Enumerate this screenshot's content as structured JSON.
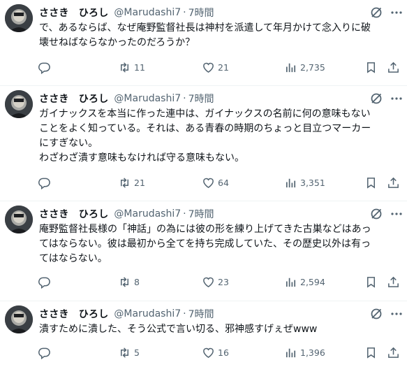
{
  "tweets": [
    {
      "name": "ささき　ひろし",
      "handle": "@Marudashi7",
      "dot": "·",
      "time": "7時間",
      "lines": [
        "で、あるならば、なぜ庵野監督社長は神村を派遣して年月かけて念入りに破",
        "壊せねばならなかったのだろうか？"
      ],
      "replies": "",
      "retweets": "11",
      "likes": "21",
      "views": "2,735"
    },
    {
      "name": "ささき　ひろし",
      "handle": "@Marudashi7",
      "dot": "·",
      "time": "7時間",
      "lines": [
        "ガイナックスを本当に作った連中は、ガイナックスの名前に何の意味もない",
        "ことをよく知っている。それは、ある青春の時期のちょっと目立つマーカー",
        "にすぎない。",
        "わざわざ潰す意味もなければ守る意味もない。"
      ],
      "replies": "",
      "retweets": "21",
      "likes": "64",
      "views": "3,351"
    },
    {
      "name": "ささき　ひろし",
      "handle": "@Marudashi7",
      "dot": "·",
      "time": "7時間",
      "lines": [
        "庵野監督社長様の「神話」の為には彼の形を練り上げてきた古巣などはあっ",
        "てはならない。彼は最初から全てを持ち完成していた、その歴史以外は有っ",
        "てはならない。"
      ],
      "replies": "",
      "retweets": "8",
      "likes": "23",
      "views": "2,594"
    },
    {
      "name": "ささき　ひろし",
      "handle": "@Marudashi7",
      "dot": "·",
      "time": "7時間",
      "lines": [
        "潰すために潰した、そう公式で言い切る、邪神感すげぇぜwww"
      ],
      "replies": "",
      "retweets": "5",
      "likes": "16",
      "views": "1,396"
    }
  ],
  "icons": {
    "avatar": "avatar",
    "mute": "grok-mute-icon",
    "more": "more-icon",
    "reply": "reply-icon",
    "retweet": "retweet-icon",
    "like": "heart-icon",
    "views": "views-chart-icon",
    "bookmark": "bookmark-icon",
    "share": "share-icon"
  },
  "colors": {
    "text": "#0f1419",
    "secondary": "#536471",
    "divider": "#eff3f4"
  }
}
